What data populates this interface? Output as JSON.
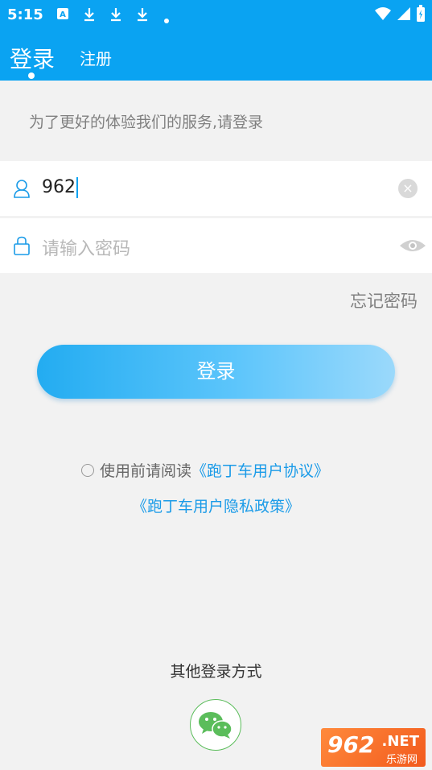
{
  "status_bar": {
    "time": "5:15",
    "icons": [
      "a-icon",
      "download-icon",
      "download-icon",
      "download-icon",
      "dot-icon"
    ],
    "right_icons": [
      "wifi-icon",
      "signal-icon",
      "battery-icon"
    ]
  },
  "header": {
    "tab_login": "登录",
    "tab_register": "注册"
  },
  "form": {
    "hint": "为了更好的体验我们的服务,请登录",
    "username_value": "962",
    "password_placeholder": "请输入密码",
    "forgot": "忘记密码",
    "login_button": "登录"
  },
  "agreement": {
    "prefix": "使用前请阅读",
    "user_agreement": "《跑丁车用户协议》",
    "privacy_policy": "《跑丁车用户隐私政策》"
  },
  "other_login": {
    "title": "其他登录方式",
    "method_icon": "wechat-icon"
  },
  "watermark": {
    "logo": "962",
    "net": ".NET",
    "site": "乐游网"
  },
  "colors": {
    "brand": "#0aa3f2",
    "link": "#1a9be8",
    "wechat": "#5bbd5b"
  }
}
